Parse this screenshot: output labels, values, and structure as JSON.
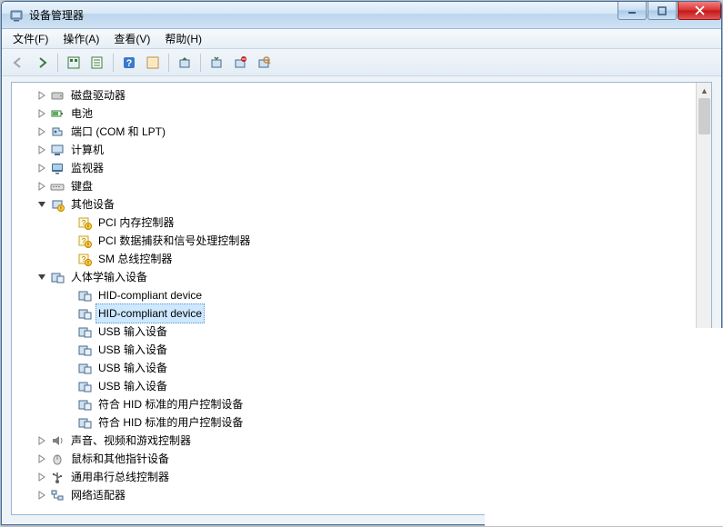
{
  "window": {
    "title": "设备管理器"
  },
  "menubar": {
    "file": "文件(F)",
    "action": "操作(A)",
    "view": "查看(V)",
    "help": "帮助(H)"
  },
  "toolbar_icons": {
    "back": "back-arrow",
    "forward": "forward-arrow",
    "show_hidden": "show-hidden",
    "properties": "properties",
    "help": "help",
    "refresh": "refresh",
    "update_driver": "update-driver",
    "uninstall": "uninstall",
    "disable": "disable",
    "scan": "scan-hardware"
  },
  "tree": {
    "categories": [
      {
        "label": "磁盘驱动器",
        "icon": "disk-drive-icon",
        "expanded": false
      },
      {
        "label": "电池",
        "icon": "battery-icon",
        "expanded": false
      },
      {
        "label": "端口 (COM 和 LPT)",
        "icon": "ports-icon",
        "expanded": false
      },
      {
        "label": "计算机",
        "icon": "computer-icon",
        "expanded": false
      },
      {
        "label": "监视器",
        "icon": "monitor-icon",
        "expanded": false
      },
      {
        "label": "键盘",
        "icon": "keyboard-icon",
        "expanded": false
      },
      {
        "label": "其他设备",
        "icon": "other-devices-icon",
        "expanded": true,
        "children": [
          {
            "label": "PCI 内存控制器",
            "icon": "unknown-device-icon"
          },
          {
            "label": "PCI 数据捕获和信号处理控制器",
            "icon": "unknown-device-icon"
          },
          {
            "label": "SM 总线控制器",
            "icon": "unknown-device-icon"
          }
        ]
      },
      {
        "label": "人体学输入设备",
        "icon": "hid-icon",
        "expanded": true,
        "children": [
          {
            "label": "HID-compliant device",
            "icon": "hid-device-icon"
          },
          {
            "label": "HID-compliant device",
            "icon": "hid-device-icon",
            "selected": true
          },
          {
            "label": "USB 输入设备",
            "icon": "hid-device-icon"
          },
          {
            "label": "USB 输入设备",
            "icon": "hid-device-icon"
          },
          {
            "label": "USB 输入设备",
            "icon": "hid-device-icon"
          },
          {
            "label": "USB 输入设备",
            "icon": "hid-device-icon"
          },
          {
            "label": "符合 HID 标准的用户控制设备",
            "icon": "hid-device-icon"
          },
          {
            "label": "符合 HID 标准的用户控制设备",
            "icon": "hid-device-icon"
          }
        ]
      },
      {
        "label": "声音、视频和游戏控制器",
        "icon": "sound-icon",
        "expanded": false
      },
      {
        "label": "鼠标和其他指针设备",
        "icon": "mouse-icon",
        "expanded": false
      },
      {
        "label": "通用串行总线控制器",
        "icon": "usb-icon",
        "expanded": false
      },
      {
        "label": "网络适配器",
        "icon": "network-icon",
        "expanded": false
      }
    ]
  }
}
